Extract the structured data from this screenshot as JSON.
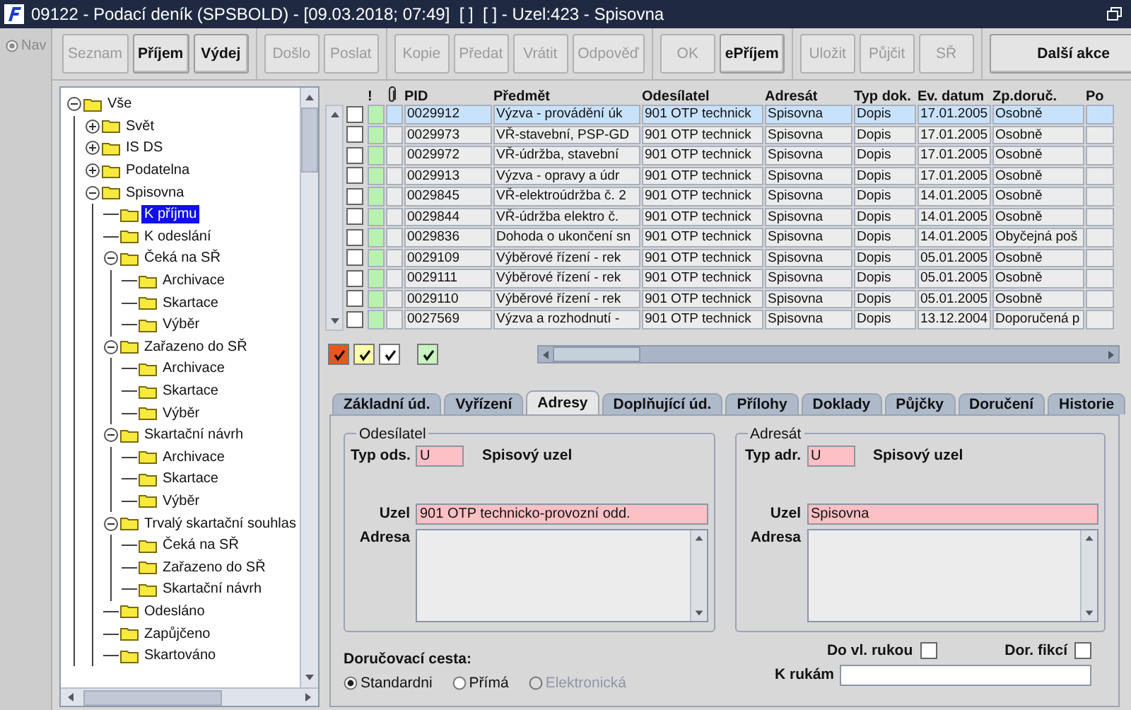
{
  "window": {
    "title": "09122 - Podací deník (SPSBOLD) - [09.03.2018; 07:49]  [ ]  [ ] - Uzel:423 - Spisovna"
  },
  "nav": {
    "label": "Nav"
  },
  "toolbar": [
    {
      "buttons": [
        {
          "label": "Seznam",
          "disabled": true
        },
        {
          "label": "Příjem",
          "disabled": false
        },
        {
          "label": "Výdej",
          "disabled": false
        }
      ]
    },
    {
      "buttons": [
        {
          "label": "Došlo",
          "disabled": true
        },
        {
          "label": "Poslat",
          "disabled": true
        }
      ]
    },
    {
      "buttons": [
        {
          "label": "Kopie",
          "disabled": true
        },
        {
          "label": "Předat",
          "disabled": true
        },
        {
          "label": "Vrátit",
          "disabled": true
        },
        {
          "label": "Odpověď",
          "disabled": true
        }
      ]
    },
    {
      "buttons": [
        {
          "label": "OK",
          "disabled": true
        },
        {
          "label": "ePříjem",
          "disabled": false
        }
      ]
    },
    {
      "buttons": [
        {
          "label": "Uložit",
          "disabled": true
        },
        {
          "label": "Půjčit",
          "disabled": true
        },
        {
          "label": "SŘ",
          "disabled": true
        }
      ]
    },
    {
      "buttons": [
        {
          "label": "Další akce",
          "disabled": false
        }
      ]
    }
  ],
  "tree": [
    {
      "label": "Vše",
      "expanded": true,
      "selected": false,
      "children": [
        {
          "label": "Svět",
          "expanded": false,
          "selected": false
        },
        {
          "label": "IS DS",
          "expanded": false,
          "selected": false
        },
        {
          "label": "Podatelna",
          "expanded": false,
          "selected": false
        },
        {
          "label": "Spisovna",
          "expanded": true,
          "selected": false,
          "children": [
            {
              "label": "K příjmu",
              "selected": true
            },
            {
              "label": "K odeslání",
              "selected": false
            },
            {
              "label": "Čeká na SŘ",
              "expanded": true,
              "selected": false,
              "children": [
                {
                  "label": "Archivace",
                  "selected": false
                },
                {
                  "label": "Skartace",
                  "selected": false
                },
                {
                  "label": "Výběr",
                  "selected": false
                }
              ]
            },
            {
              "label": "Zařazeno do SŘ",
              "expanded": true,
              "selected": false,
              "children": [
                {
                  "label": "Archivace",
                  "selected": false
                },
                {
                  "label": "Skartace",
                  "selected": false
                },
                {
                  "label": "Výběr",
                  "selected": false
                }
              ]
            },
            {
              "label": "Skartační návrh",
              "expanded": true,
              "selected": false,
              "children": [
                {
                  "label": "Archivace",
                  "selected": false
                },
                {
                  "label": "Skartace",
                  "selected": false
                },
                {
                  "label": "Výběr",
                  "selected": false
                }
              ]
            },
            {
              "label": "Trvalý skartační souhlas",
              "expanded": true,
              "selected": false,
              "children": [
                {
                  "label": "Čeká na SŘ",
                  "selected": false
                },
                {
                  "label": "Zařazeno do SŘ",
                  "selected": false
                },
                {
                  "label": "Skartační návrh",
                  "selected": false
                }
              ]
            },
            {
              "label": "Odesláno",
              "selected": false
            },
            {
              "label": "Zapůjčeno",
              "selected": false
            },
            {
              "label": "Skartováno",
              "selected": false
            }
          ]
        }
      ]
    }
  ],
  "table": {
    "flag_header": "!",
    "columns": [
      "PID",
      "Předmět",
      "Odesílatel",
      "Adresát",
      "Typ dok.",
      "Ev. datum",
      "Zp.doruč.",
      "Po"
    ],
    "rows": [
      {
        "checked": false,
        "selected": true,
        "color": "#b8f2b0",
        "cells": [
          "0029912",
          "Výzva - provádění úk",
          "901 OTP technick",
          "Spisovna",
          "Dopis",
          "17.01.2005",
          "Osobně"
        ]
      },
      {
        "checked": false,
        "selected": false,
        "color": "#b8f2b0",
        "cells": [
          "0029973",
          "VŘ-stavební, PSP-GD",
          "901 OTP technick",
          "Spisovna",
          "Dopis",
          "17.01.2005",
          "Osobně"
        ]
      },
      {
        "checked": false,
        "selected": false,
        "color": "#b8f2b0",
        "cells": [
          "0029972",
          "VŘ-údržba, stavební",
          "901 OTP technick",
          "Spisovna",
          "Dopis",
          "17.01.2005",
          "Osobně"
        ]
      },
      {
        "checked": false,
        "selected": false,
        "color": "#b8f2b0",
        "cells": [
          "0029913",
          "Výzva - opravy a údr",
          "901 OTP technick",
          "Spisovna",
          "Dopis",
          "17.01.2005",
          "Osobně"
        ]
      },
      {
        "checked": false,
        "selected": false,
        "color": "#b8f2b0",
        "cells": [
          "0029845",
          "VŘ-elektroúdržba č. 2",
          "901 OTP technick",
          "Spisovna",
          "Dopis",
          "14.01.2005",
          "Osobně"
        ]
      },
      {
        "checked": false,
        "selected": false,
        "color": "#b8f2b0",
        "cells": [
          "0029844",
          "VŘ-údržba elektro č.",
          "901 OTP technick",
          "Spisovna",
          "Dopis",
          "14.01.2005",
          "Osobně"
        ]
      },
      {
        "checked": false,
        "selected": false,
        "color": "#b8f2b0",
        "cells": [
          "0029836",
          "Dohoda o ukončení sn",
          "901 OTP technick",
          "Spisovna",
          "Dopis",
          "14.01.2005",
          "Obyčejná poš"
        ]
      },
      {
        "checked": false,
        "selected": false,
        "color": "#b8f2b0",
        "cells": [
          "0029109",
          "Výběrové řízení - rek",
          "901 OTP technick",
          "Spisovna",
          "Dopis",
          "05.01.2005",
          "Osobně"
        ]
      },
      {
        "checked": false,
        "selected": false,
        "color": "#b8f2b0",
        "cells": [
          "0029111",
          "Výběrové řízení  - rek",
          "901 OTP technick",
          "Spisovna",
          "Dopis",
          "05.01.2005",
          "Osobně"
        ]
      },
      {
        "checked": false,
        "selected": false,
        "color": "#b8f2b0",
        "cells": [
          "0029110",
          "Výběrové řízení - rek",
          "901 OTP technick",
          "Spisovna",
          "Dopis",
          "05.01.2005",
          "Osobně"
        ]
      },
      {
        "checked": false,
        "selected": false,
        "color": "#b8f2b0",
        "cells": [
          "0027569",
          "Výzva a rozhodnutí -",
          "901 OTP technick",
          "Spisovna",
          "Dopis",
          "13.12.2004",
          "Doporučená p"
        ]
      }
    ]
  },
  "legend": [
    {
      "checked": true,
      "color": "#e8561e"
    },
    {
      "checked": true,
      "color": "#ffffa8"
    },
    {
      "checked": true,
      "color": "#ffffff"
    },
    {
      "checked": true,
      "color": "#c8f5c0"
    }
  ],
  "tabs": [
    {
      "label": "Základní úd.",
      "selected": false
    },
    {
      "label": "Vyřízení",
      "selected": false
    },
    {
      "label": "Adresy",
      "selected": true
    },
    {
      "label": "Doplňující úd.",
      "selected": false
    },
    {
      "label": "Přílohy",
      "selected": false
    },
    {
      "label": "Doklady",
      "selected": false
    },
    {
      "label": "Půjčky",
      "selected": false
    },
    {
      "label": "Doručení",
      "selected": false
    },
    {
      "label": "Historie",
      "selected": false
    }
  ],
  "parties": [
    {
      "legend": "Odesílatel",
      "type_label": "Typ ods.",
      "type_value": "U",
      "type_name": "Spisový uzel",
      "node_label": "Uzel",
      "node_value": "901 OTP technicko-provozní odd.",
      "address_label": "Adresa"
    },
    {
      "legend": "Adresát",
      "type_label": "Typ adr.",
      "type_value": "U",
      "type_name": "Spisový uzel",
      "node_label": "Uzel",
      "node_value": "Spisovna",
      "address_label": "Adresa"
    }
  ],
  "delivery": {
    "label": "Doručovací cesta:",
    "options": [
      {
        "label": "Standardni",
        "selected": true,
        "disabled": false
      },
      {
        "label": "Přímá",
        "selected": false,
        "disabled": false
      },
      {
        "label": "Elektronická",
        "selected": false,
        "disabled": true
      }
    ]
  },
  "flags": [
    {
      "label": "Do vl. rukou",
      "checked": false
    },
    {
      "label": "Dor. fikcí",
      "checked": false
    }
  ],
  "k_rukam": {
    "label": "K rukám"
  }
}
